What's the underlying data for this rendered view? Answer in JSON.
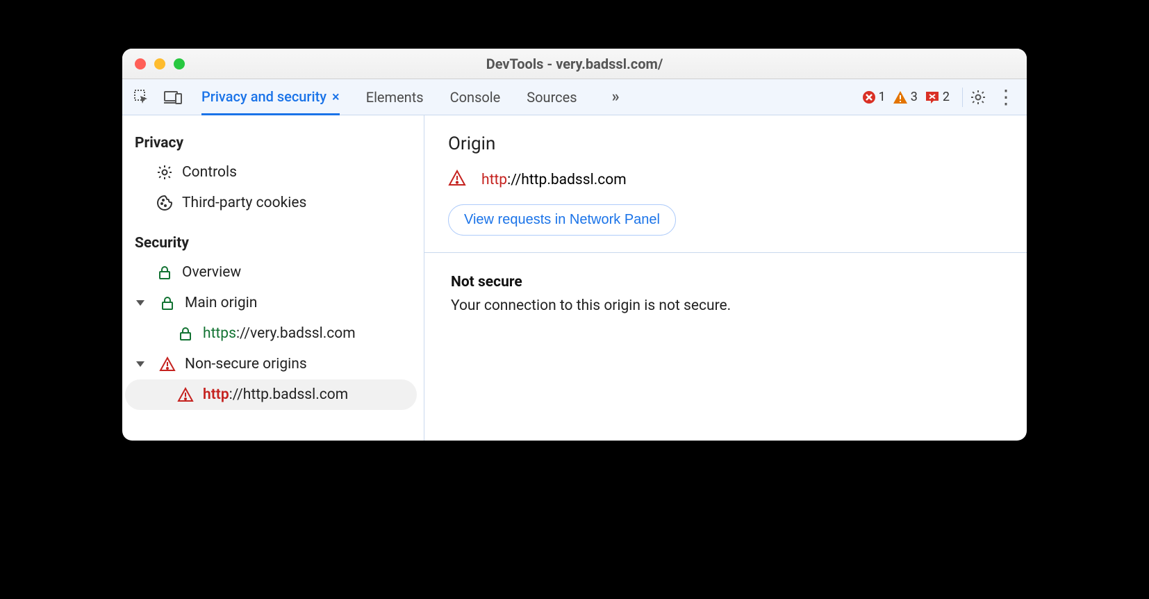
{
  "window": {
    "title": "DevTools - very.badssl.com/"
  },
  "toolbar": {
    "tabs": {
      "active": "Privacy and security",
      "t1": "Elements",
      "t2": "Console",
      "t3": "Sources"
    },
    "status": {
      "errors": "1",
      "warnings": "3",
      "issues": "2"
    }
  },
  "sidebar": {
    "privacy": {
      "header": "Privacy",
      "controls": "Controls",
      "cookies": "Third-party cookies"
    },
    "security": {
      "header": "Security",
      "overview": "Overview",
      "main_origin": "Main origin",
      "main_origin_item_scheme": "https",
      "main_origin_item_rest": "://very.badssl.com",
      "nonsecure": "Non-secure origins",
      "nonsecure_item_scheme": "http",
      "nonsecure_item_rest": "://http.badssl.com"
    }
  },
  "main": {
    "origin_heading": "Origin",
    "origin_scheme": "http",
    "origin_rest": "://http.badssl.com",
    "view_requests": "View requests in Network Panel",
    "not_secure_title": "Not secure",
    "not_secure_desc": "Your connection to this origin is not secure."
  }
}
